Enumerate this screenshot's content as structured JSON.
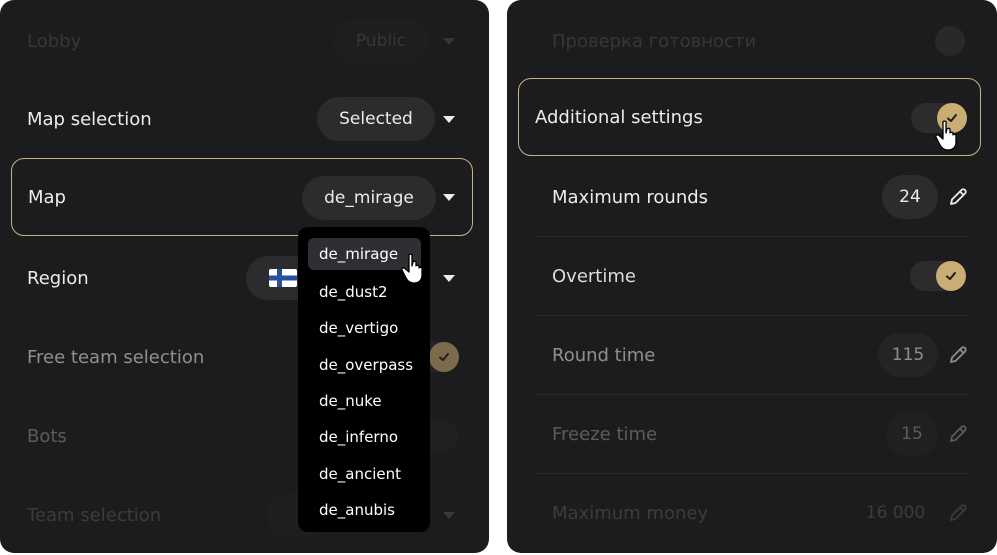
{
  "left_panel": {
    "lobby": {
      "label": "Lobby",
      "value": "Public"
    },
    "map_selection": {
      "label": "Map selection",
      "value": "Selected"
    },
    "map": {
      "label": "Map",
      "value": "de_mirage"
    },
    "region": {
      "label": "Region"
    },
    "free_team": {
      "label": "Free team selection",
      "checked": true
    },
    "bots": {
      "label": "Bots"
    },
    "team_selection": {
      "label": "Team selection"
    },
    "map_options": [
      "de_mirage",
      "de_dust2",
      "de_vertigo",
      "de_overpass",
      "de_nuke",
      "de_inferno",
      "de_ancient",
      "de_anubis"
    ]
  },
  "right_panel": {
    "readiness": {
      "label": "Проверка готовности",
      "checked": true
    },
    "additional_settings": {
      "label": "Additional settings",
      "enabled": true
    },
    "max_rounds": {
      "label": "Maximum rounds",
      "value": "24"
    },
    "overtime": {
      "label": "Overtime",
      "enabled": true
    },
    "round_time": {
      "label": "Round time",
      "value": "115"
    },
    "freeze_time": {
      "label": "Freeze time",
      "value": "15"
    },
    "max_money": {
      "label": "Maximum money",
      "value": "16 000"
    }
  },
  "colors": {
    "panel_bg": "#1c1c1e",
    "accent": "#c9ad72",
    "highlight_border": "#c9b47f",
    "pill_bg": "#2c2c2f"
  }
}
